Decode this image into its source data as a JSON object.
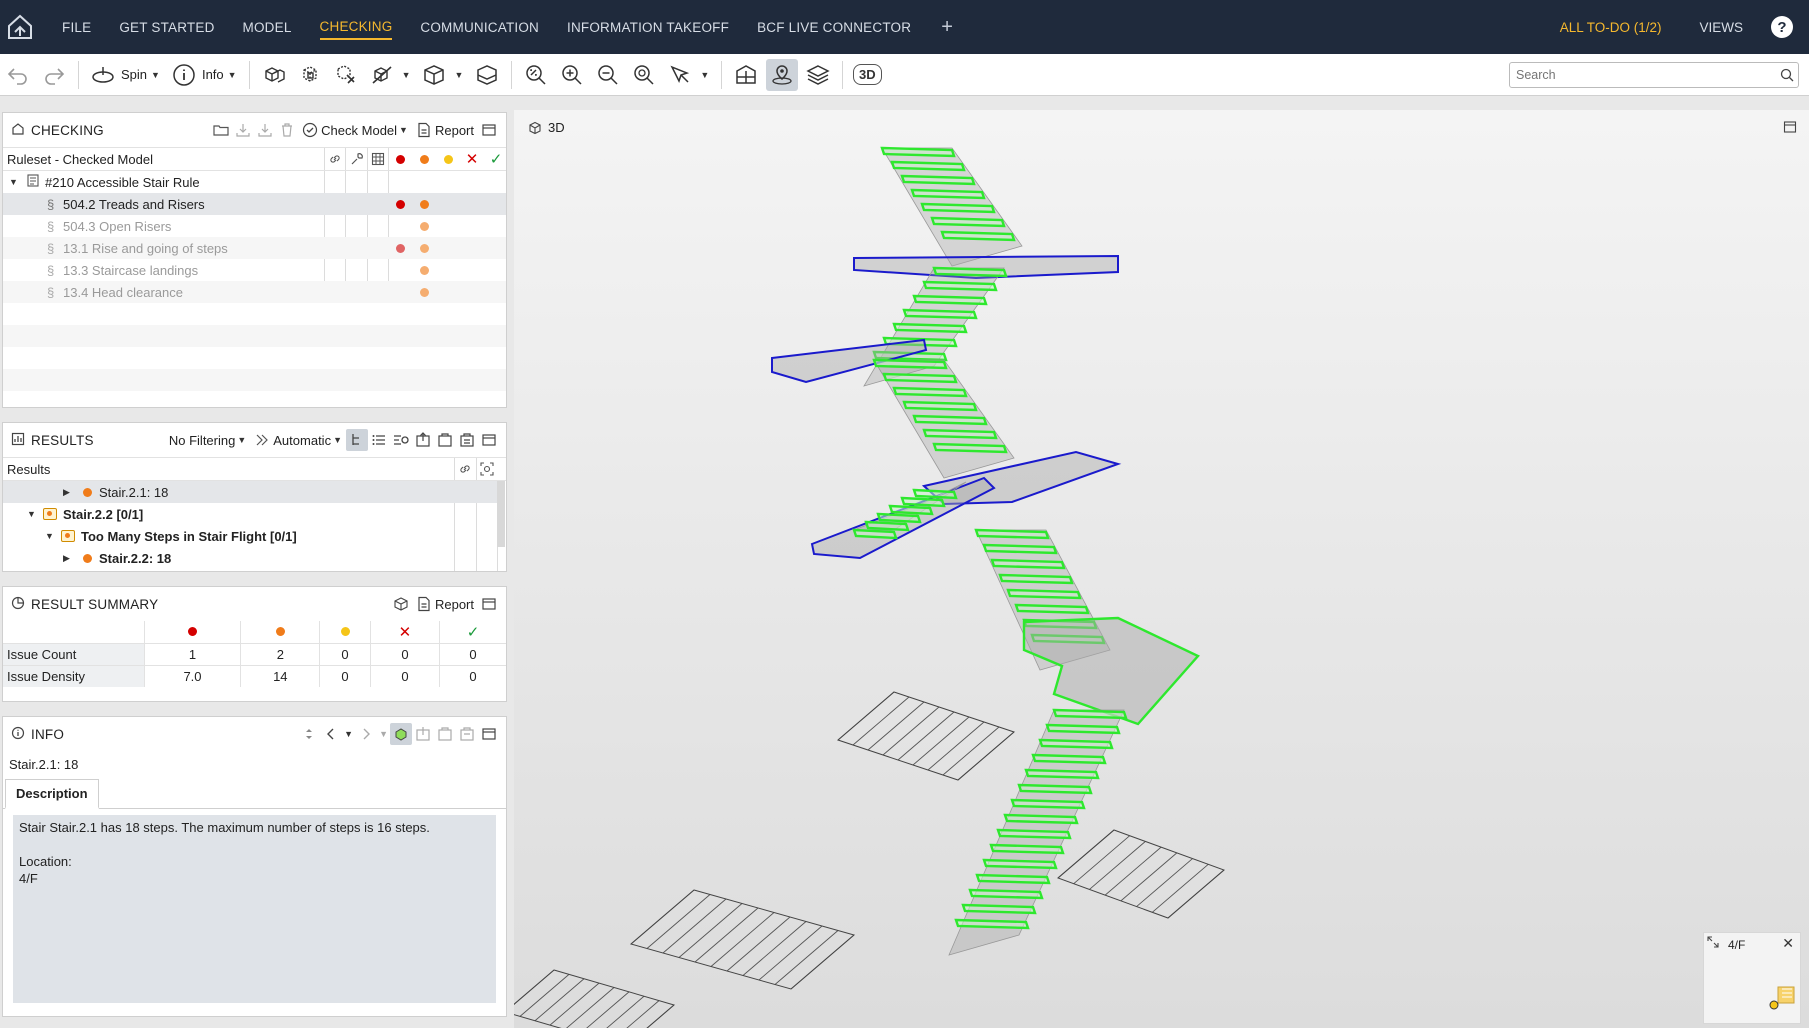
{
  "nav": {
    "items": [
      "FILE",
      "GET STARTED",
      "MODEL",
      "CHECKING",
      "COMMUNICATION",
      "INFORMATION TAKEOFF",
      "BCF LIVE CONNECTOR"
    ],
    "plus": "+",
    "todo": "ALL TO-DO (1/2)",
    "views": "VIEWS",
    "help": "?"
  },
  "toolbar": {
    "spin_label": "Spin",
    "info_label": "Info",
    "text_3d": "3D",
    "search_placeholder": "Search"
  },
  "checking": {
    "title": "CHECKING",
    "check_model": "Check Model",
    "report": "Report",
    "header_label": "Ruleset - Checked Model",
    "rule_group": "#210 Accessible Stair Rule",
    "rules": [
      {
        "section": "§",
        "label": "504.2 Treads and Risers",
        "red": true,
        "orange": true,
        "faded": false
      },
      {
        "section": "§",
        "label": "504.3 Open Risers",
        "red": false,
        "orange": true,
        "faded": true
      },
      {
        "section": "§",
        "label": "13.1 Rise and going of steps",
        "red": true,
        "orange": true,
        "faded": true
      },
      {
        "section": "§",
        "label": "13.3 Staircase landings",
        "red": false,
        "orange": true,
        "faded": true
      },
      {
        "section": "§",
        "label": "13.4 Head clearance",
        "red": false,
        "orange": true,
        "faded": true
      }
    ]
  },
  "results": {
    "title": "RESULTS",
    "filter": "No Filtering",
    "mode": "Automatic",
    "header_label": "Results",
    "rows": [
      {
        "label": "Stair.2.1: 18"
      },
      {
        "label": "Stair.2.2 [0/1]"
      },
      {
        "label": "Too Many Steps in Stair Flight [0/1]"
      },
      {
        "label": "Stair.2.2: 18"
      }
    ]
  },
  "summary": {
    "title": "RESULT SUMMARY",
    "report": "Report",
    "rows": [
      {
        "label": "Issue Count",
        "values": [
          "1",
          "2",
          "0",
          "0",
          "0"
        ]
      },
      {
        "label": "Issue Density",
        "values": [
          "7.0",
          "14",
          "0",
          "0",
          "0"
        ]
      }
    ]
  },
  "info": {
    "title": "INFO",
    "selected": "Stair.2.1: 18",
    "tab": "Description",
    "description": "Stair Stair.2.1 has 18 steps. The maximum number of steps is 16 steps.\n\nLocation:\n4/F"
  },
  "viewport": {
    "label": "3D",
    "minimap_floor": "4/F",
    "minimap_close": "✕"
  },
  "colors": {
    "nav_bg": "#1f2a3c",
    "accent": "#f5b82e",
    "critical": "#d40000",
    "moderate": "#f07c1a",
    "low": "#f5c518",
    "rejected": "#d40000",
    "accepted": "#1a9a3a",
    "stair_highlight": "#2ee82e",
    "landing_outline": "#1a1acc"
  }
}
